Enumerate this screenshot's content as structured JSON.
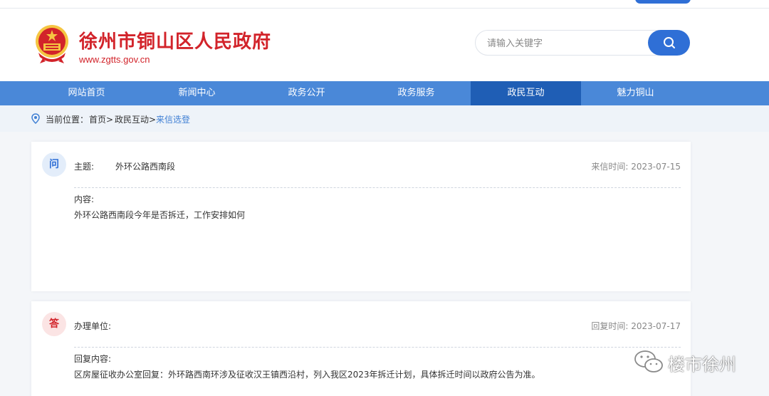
{
  "header": {
    "site_title": "徐州市铜山区人民政府",
    "site_url": "www.zgtts.gov.cn",
    "search_placeholder": "请输入关键字"
  },
  "nav": {
    "items": [
      "网站首页",
      "新闻中心",
      "政务公开",
      "政务服务",
      "政民互动",
      "魅力铜山"
    ],
    "active": "政民互动"
  },
  "breadcrumb": {
    "prefix": "当前位置：",
    "home": "首页>",
    "section": "政民互动>",
    "current": "来信选登"
  },
  "question": {
    "badge": "问",
    "subject_label": "主题:",
    "subject": "外环公路西南段",
    "date_label": "来信时间:",
    "date": "2023-07-15",
    "content_label": "内容:",
    "content": "外环公路西南段今年是否拆迁，工作安排如何"
  },
  "answer": {
    "badge": "答",
    "unit_label": "办理单位:",
    "unit": "",
    "date_label": "回复时间:",
    "date": "2023-07-17",
    "content_label": "回复内容:",
    "content": "区房屋征收办公室回复：外环路西南环涉及征收汉王镇西沿村，列入我区2023年拆迁计划，具体拆迁时间以政府公告为准。"
  },
  "watermark": {
    "text": "楼市徐州",
    "icon": "wechat-icon"
  },
  "colors": {
    "brand_red": "#d2232a",
    "nav_blue": "#4a88d8",
    "nav_active": "#1f5eb5",
    "accent_blue": "#2f6fd6"
  }
}
